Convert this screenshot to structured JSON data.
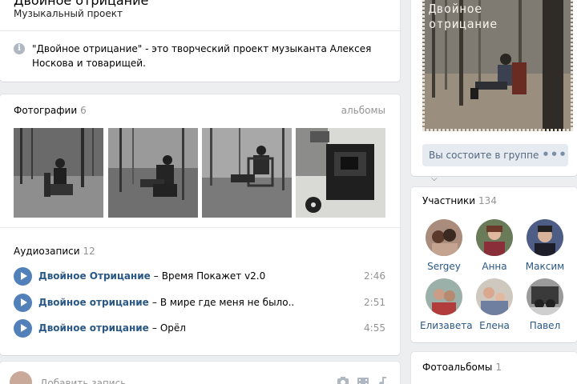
{
  "header": {
    "title": "Двойное отрицание",
    "status": "Музыкальный проект",
    "info_icon": "info-icon",
    "description": "\"Двойное отрицание\" - это творческий проект музыканта Алексея Носкова и товарищей."
  },
  "photos": {
    "label": "Фотографии",
    "count": "6",
    "albums_link": "альбомы"
  },
  "audio": {
    "label": "Аудиозаписи",
    "count": "12",
    "tracks": [
      {
        "artist": "Двойное Отрицание",
        "sep": "–",
        "title": "Время Покажет v2.0",
        "duration": "2:46"
      },
      {
        "artist": "Двойное отрицание",
        "sep": "–",
        "title": "В мире где меня не было..",
        "duration": "2:51"
      },
      {
        "artist": "Двойное отрицание",
        "sep": "–",
        "title": "Орёл",
        "duration": "4:55"
      }
    ]
  },
  "post": {
    "placeholder": "Добавить запись"
  },
  "cover": {
    "title_line1": "Двойное",
    "title_line2": "отрицание"
  },
  "membership": {
    "button_label": "Вы состоите в группе",
    "chevron": "⌵",
    "more_label": "•••"
  },
  "members": {
    "label": "Участники",
    "count": "134",
    "people": [
      {
        "name": "Sergey"
      },
      {
        "name": "Анна"
      },
      {
        "name": "Максим"
      },
      {
        "name": "Елизавета"
      },
      {
        "name": "Елена"
      },
      {
        "name": "Павел"
      }
    ]
  },
  "photo_albums": {
    "label": "Фотоальбомы",
    "count": "1"
  },
  "colors": {
    "link": "#2a5885",
    "play_button": "#5181b8",
    "muted": "#939393",
    "page_bg": "#edeef0"
  }
}
